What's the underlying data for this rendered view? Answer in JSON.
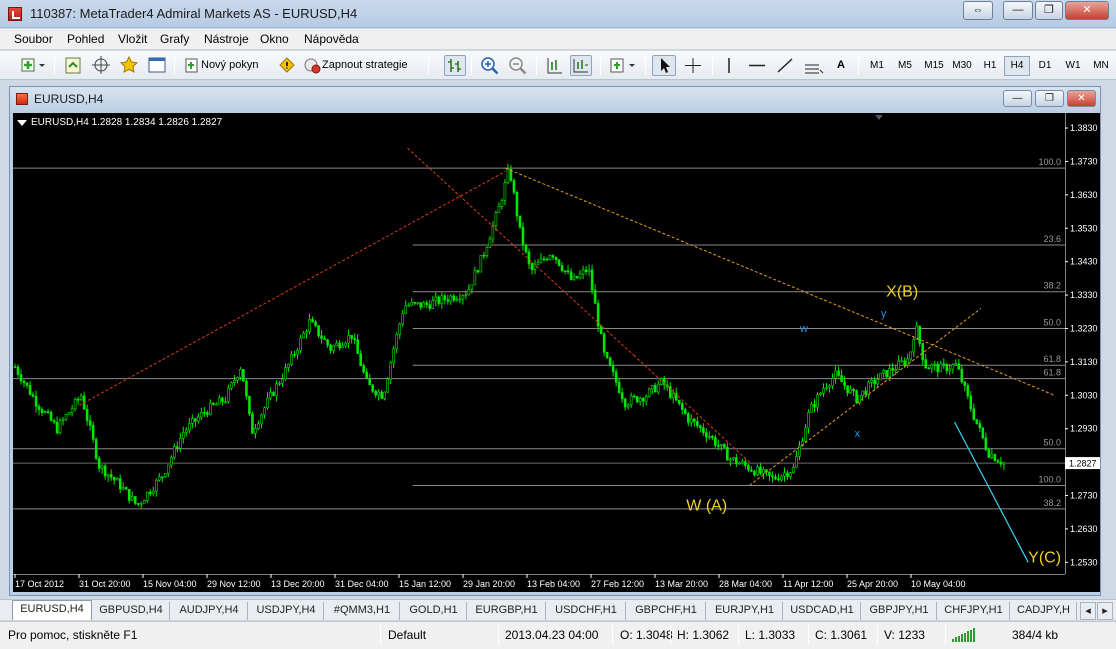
{
  "window": {
    "title": "110387: MetaTrader4 Admiral Markets AS - EURUSD,H4",
    "controls": [
      "⇔",
      "—",
      "❐",
      "✕"
    ]
  },
  "menu": [
    "Soubor",
    "Pohled",
    "Vložit",
    "Grafy",
    "Nástroje",
    "Okno",
    "Nápověda"
  ],
  "toolbar": {
    "new_order": "Nový pokyn",
    "autotrading": "Zapnout strategie",
    "text_tool": "A",
    "timeframes": [
      "M1",
      "M5",
      "M15",
      "M30",
      "H1",
      "H4",
      "D1",
      "W1",
      "MN"
    ],
    "active_timeframe": "H4"
  },
  "chart_window": {
    "title": "EURUSD,H4"
  },
  "chart_data": {
    "type": "candlestick",
    "symbol_header": "EURUSD,H4  1.2828 1.2834 1.2826 1.2827",
    "current_price": "1.2827",
    "ylim": [
      1.2495,
      1.3875
    ],
    "y_ticks": [
      "1.3830",
      "1.3730",
      "1.3630",
      "1.3530",
      "1.3430",
      "1.3330",
      "1.3230",
      "1.3130",
      "1.3030",
      "1.2930",
      "1.2730",
      "1.2630",
      "1.2530"
    ],
    "x_ticks": [
      "17 Oct 2012",
      "31 Oct 20:00",
      "15 Nov 04:00",
      "29 Nov 12:00",
      "13 Dec 20:00",
      "31 Dec 04:00",
      "15 Jan 12:00",
      "29 Jan 20:00",
      "13 Feb 04:00",
      "27 Feb 12:00",
      "13 Mar 20:00",
      "28 Mar 04:00",
      "11 Apr 12:00",
      "25 Apr 20:00",
      "10 May 04:00"
    ],
    "price_path": [
      [
        0,
        1.3115
      ],
      [
        0.02,
        1.301
      ],
      [
        0.04,
        1.293
      ],
      [
        0.063,
        1.303
      ],
      [
        0.08,
        1.282
      ],
      [
        0.1,
        1.276
      ],
      [
        0.116,
        1.27
      ],
      [
        0.14,
        1.279
      ],
      [
        0.16,
        1.292
      ],
      [
        0.18,
        1.298
      ],
      [
        0.2,
        1.302
      ],
      [
        0.215,
        1.312
      ],
      [
        0.225,
        1.292
      ],
      [
        0.24,
        1.301
      ],
      [
        0.26,
        1.312
      ],
      [
        0.28,
        1.325
      ],
      [
        0.3,
        1.317
      ],
      [
        0.32,
        1.321
      ],
      [
        0.335,
        1.306
      ],
      [
        0.35,
        1.303
      ],
      [
        0.36,
        1.317
      ],
      [
        0.37,
        1.33
      ],
      [
        0.39,
        1.33
      ],
      [
        0.41,
        1.332
      ],
      [
        0.43,
        1.334
      ],
      [
        0.445,
        1.345
      ],
      [
        0.46,
        1.359
      ],
      [
        0.47,
        1.371
      ],
      [
        0.48,
        1.352
      ],
      [
        0.49,
        1.34
      ],
      [
        0.51,
        1.346
      ],
      [
        0.53,
        1.337
      ],
      [
        0.545,
        1.341
      ],
      [
        0.56,
        1.315
      ],
      [
        0.58,
        1.301
      ],
      [
        0.6,
        1.303
      ],
      [
        0.615,
        1.307
      ],
      [
        0.64,
        1.296
      ],
      [
        0.66,
        1.291
      ],
      [
        0.68,
        1.284
      ],
      [
        0.7,
        1.281
      ],
      [
        0.72,
        1.278
      ],
      [
        0.74,
        1.281
      ],
      [
        0.755,
        1.298
      ],
      [
        0.77,
        1.306
      ],
      [
        0.78,
        1.309
      ],
      [
        0.8,
        1.302
      ],
      [
        0.82,
        1.308
      ],
      [
        0.835,
        1.311
      ],
      [
        0.85,
        1.314
      ],
      [
        0.856,
        1.324
      ],
      [
        0.865,
        1.312
      ],
      [
        0.88,
        1.311
      ],
      [
        0.895,
        1.312
      ],
      [
        0.91,
        1.298
      ],
      [
        0.925,
        1.286
      ],
      [
        0.94,
        1.2827
      ]
    ],
    "fib_levels": [
      {
        "label": "100.0",
        "price": 1.371,
        "x0": 0.0
      },
      {
        "label": "23.6",
        "price": 1.348,
        "x0": 0.38
      },
      {
        "label": "38.2",
        "price": 1.334,
        "x0": 0.38
      },
      {
        "label": "50.0",
        "price": 1.323,
        "x0": 0.38
      },
      {
        "label": "61.8",
        "price": 1.312,
        "x0": 0.38
      },
      {
        "label": "61.8",
        "price": 1.308,
        "x0": 0.0
      },
      {
        "label": "50.0",
        "price": 1.287,
        "x0": 0.0
      },
      {
        "label": "100.0",
        "price": 1.276,
        "x0": 0.38
      },
      {
        "label": "38.2",
        "price": 1.269,
        "x0": 0.0
      }
    ],
    "trendlines": [
      {
        "from": [
          0.063,
          1.3
        ],
        "to": [
          0.468,
          1.37
        ],
        "color": "#d93a1a"
      },
      {
        "from": [
          0.375,
          1.377
        ],
        "to": [
          0.59,
          1.315
        ],
        "color": "#d93a1a"
      },
      {
        "from": [
          0.59,
          1.315
        ],
        "to": [
          0.7,
          1.283
        ],
        "color": "#d93a1a"
      },
      {
        "from": [
          0.468,
          1.371
        ],
        "to": [
          0.99,
          1.303
        ],
        "color": "#e59a1e"
      },
      {
        "from": [
          0.7,
          1.276
        ],
        "to": [
          0.92,
          1.329
        ],
        "color": "#e59a1e"
      }
    ],
    "projection_line": {
      "from": [
        0.895,
        1.295
      ],
      "to": [
        0.965,
        1.253
      ],
      "color": "#3fd4f2"
    },
    "labels": [
      {
        "text": "X(B)",
        "at": [
          0.83,
          1.3325
        ],
        "color": "#f0d022",
        "size": 16
      },
      {
        "text": "W (A)",
        "at": [
          0.64,
          1.2685
        ],
        "color": "#f0d022",
        "size": 16
      },
      {
        "text": "Y(C)",
        "at": [
          0.965,
          1.253
        ],
        "color": "#f0d022",
        "size": 16
      },
      {
        "text": "w",
        "at": [
          0.748,
          1.322
        ],
        "color": "#2f8fe0",
        "size": 11
      },
      {
        "text": "y",
        "at": [
          0.825,
          1.3265
        ],
        "color": "#2f8fe0",
        "size": 11
      },
      {
        "text": "x",
        "at": [
          0.8,
          1.2905
        ],
        "color": "#2f8fe0",
        "size": 11
      }
    ]
  },
  "symbol_tabs": [
    "EURUSD,H4",
    "GBPUSD,H4",
    "AUDJPY,H4",
    "USDJPY,H4",
    "#QMM3,H1",
    "GOLD,H1",
    "EURGBP,H1",
    "USDCHF,H1",
    "GBPCHF,H1",
    "EURJPY,H1",
    "USDCAD,H1",
    "GBPJPY,H1",
    "CHFJPY,H1",
    "CADJPY,H"
  ],
  "status": {
    "help": "Pro pomoc, stiskněte F1",
    "profile": "Default",
    "datetime": "2013.04.23 04:00",
    "open": "O: 1.3048",
    "high": "H: 1.3062",
    "low": "L: 1.3033",
    "close": "C: 1.3061",
    "volume": "V: 1233",
    "traffic": "384/4 kb"
  },
  "colors": {
    "chart_bg": "#000000",
    "candle_bull": "#00e600",
    "candle_bear": "#00e600",
    "grid": "#3a3a3a",
    "axis_text": "#ffffff",
    "fib_line": "#8a8a8a"
  }
}
